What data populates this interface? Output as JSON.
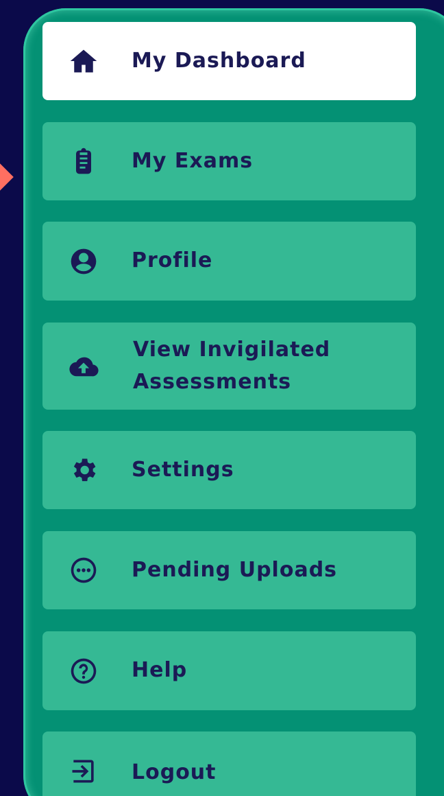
{
  "menu": {
    "items": [
      {
        "label": "My Dashboard",
        "icon": "home-icon",
        "active": true
      },
      {
        "label": "My Exams",
        "icon": "clipboard-icon",
        "active": false
      },
      {
        "label": "Profile",
        "icon": "user-circle-icon",
        "active": false
      },
      {
        "label_line1": "View Invigilated",
        "label_line2": "Assessments",
        "icon": "cloud-upload-icon",
        "active": false
      },
      {
        "label": "Settings",
        "icon": "gear-icon",
        "active": false
      },
      {
        "label": "Pending Uploads",
        "icon": "more-circle-icon",
        "active": false
      },
      {
        "label": "Help",
        "icon": "question-circle-icon",
        "active": false
      },
      {
        "label": "Logout",
        "icon": "logout-icon",
        "active": false
      }
    ]
  },
  "colors": {
    "background": "#0b0a4a",
    "drawer": "#049174",
    "item": "#35b994",
    "active_item": "#ffffff",
    "text": "#1b1a55",
    "pointer": "#ff6f61"
  }
}
